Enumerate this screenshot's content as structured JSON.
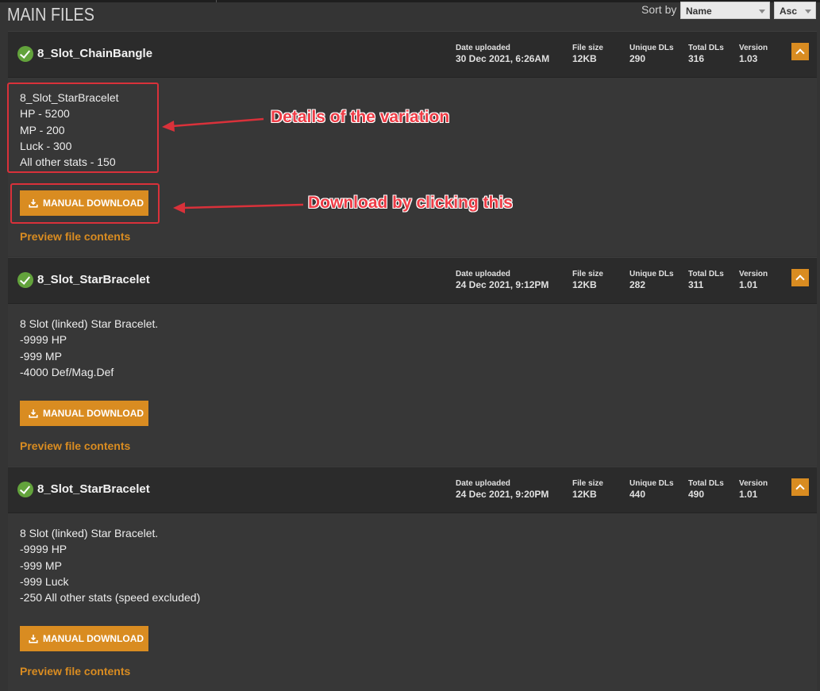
{
  "header": {
    "section_title": "MAIN FILES",
    "sort_label": "Sort by",
    "sort_field": "Name",
    "sort_order": "Asc"
  },
  "stat_labels": {
    "date": "Date uploaded",
    "size": "File size",
    "unique": "Unique DLs",
    "total": "Total DLs",
    "version": "Version"
  },
  "files": [
    {
      "name": "8_Slot_ChainBangle",
      "date": "30 Dec 2021, 6:26AM",
      "size": "12KB",
      "unique_dls": "290",
      "total_dls": "316",
      "version": "1.03",
      "description": [
        "8_Slot_StarBracelet",
        "HP - 5200",
        "MP - 200",
        "Luck - 300",
        "All other stats - 150"
      ],
      "download_label": "MANUAL DOWNLOAD",
      "preview_label": "Preview file contents"
    },
    {
      "name": "8_Slot_StarBracelet",
      "date": "24 Dec 2021, 9:12PM",
      "size": "12KB",
      "unique_dls": "282",
      "total_dls": "311",
      "version": "1.01",
      "description": [
        "8 Slot (linked) Star Bracelet.",
        "-9999 HP",
        "-999 MP",
        "-4000 Def/Mag.Def"
      ],
      "download_label": "MANUAL DOWNLOAD",
      "preview_label": "Preview file contents"
    },
    {
      "name": "8_Slot_StarBracelet",
      "date": "24 Dec 2021, 9:20PM",
      "size": "12KB",
      "unique_dls": "440",
      "total_dls": "490",
      "version": "1.01",
      "description": [
        "8 Slot (linked) Star Bracelet.",
        "-9999 HP",
        "-999 MP",
        "-999 Luck",
        "-250 All other stats (speed excluded)"
      ],
      "download_label": "MANUAL DOWNLOAD",
      "preview_label": "Preview file contents"
    }
  ],
  "annotations": {
    "details_text": "Details of the variation",
    "download_text": "Download by clicking this",
    "color": "#ee3c46"
  },
  "icons": {
    "status": "check-circle-icon",
    "download": "download-icon",
    "collapse": "chevron-up-icon"
  }
}
